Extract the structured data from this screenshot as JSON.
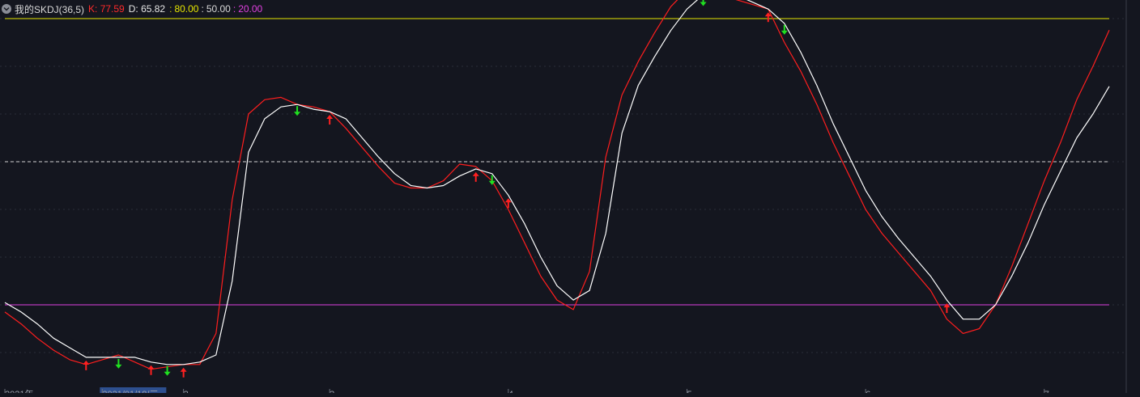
{
  "header": {
    "title": "我的SKDJ(36,5)",
    "k_label": "K: 77.59",
    "d_label": "D: 65.82",
    "level_80": "80.00",
    "level_50": "50.00",
    "level_20": "20.00",
    "colon": ":"
  },
  "colors": {
    "background": "#14161f",
    "k_line": "#ff1e1e",
    "d_line": "#ffffff",
    "level_80": "#e6e600",
    "level_50": "#d0d0d0",
    "level_20": "#e040e0",
    "up_arrow": "#ff2020",
    "down_arrow": "#20e020",
    "grid": "#2a2d38"
  },
  "chart_data": {
    "type": "line",
    "title": "我的SKDJ(36,5)",
    "ylim": [
      0,
      100
    ],
    "reference_lines": [
      80,
      50,
      20
    ],
    "grid": true,
    "x": [
      0,
      1,
      2,
      3,
      4,
      5,
      6,
      7,
      8,
      9,
      10,
      11,
      12,
      13,
      14,
      15,
      16,
      17,
      18,
      19,
      20,
      21,
      22,
      23,
      24,
      25,
      26,
      27,
      28,
      29,
      30,
      31,
      32,
      33,
      34,
      35,
      36,
      37,
      38,
      39,
      40,
      41,
      42,
      43,
      44,
      45,
      46,
      47,
      48,
      49,
      50,
      51,
      52,
      53,
      54,
      55,
      56,
      57,
      58,
      59,
      60,
      61,
      62,
      63,
      64,
      65,
      66,
      67,
      68
    ],
    "series": [
      {
        "name": "K",
        "values": [
          18.5,
          16,
          13,
          10.5,
          8.5,
          7.5,
          8.5,
          9.5,
          8,
          6.5,
          7,
          7.5,
          7.5,
          14,
          42,
          60,
          63,
          63.5,
          62,
          61.5,
          60.5,
          57,
          53,
          49,
          45.5,
          44.5,
          44.5,
          46,
          49.5,
          49,
          46,
          40,
          33,
          26,
          21,
          19,
          27,
          51,
          64,
          71,
          77,
          82.5,
          86,
          87,
          86.5,
          84,
          83,
          82,
          75,
          69,
          62,
          54,
          47,
          40,
          35,
          31,
          27,
          23,
          17,
          14,
          15,
          20,
          28,
          37,
          46,
          54,
          63,
          70,
          77.6
        ]
      },
      {
        "name": "D",
        "values": [
          20.5,
          18.5,
          16,
          13,
          11,
          9,
          9,
          9,
          9,
          8,
          7.5,
          7.5,
          8,
          9.5,
          25,
          52,
          59,
          61.5,
          62,
          61,
          60.5,
          59,
          55,
          51,
          47.5,
          45,
          44.5,
          45,
          47,
          48.5,
          47.5,
          43,
          37,
          30,
          24,
          21,
          23,
          35,
          56,
          66,
          72,
          77.5,
          82,
          85,
          86,
          85,
          83.5,
          82,
          79,
          73,
          66,
          58,
          51,
          44,
          38.5,
          34,
          30,
          26,
          21,
          17,
          17,
          20,
          26,
          33,
          41,
          48,
          55,
          60,
          65.8
        ]
      }
    ],
    "buy_signal_indices": [
      5,
      9,
      11,
      20,
      29,
      31,
      47,
      58
    ],
    "sell_signal_indices": [
      7,
      10,
      18,
      30,
      43,
      48
    ],
    "x_tick_labels": [
      "2021年",
      "2021/01/18/三",
      "2",
      "3",
      "4",
      "5",
      "6",
      "7"
    ]
  }
}
